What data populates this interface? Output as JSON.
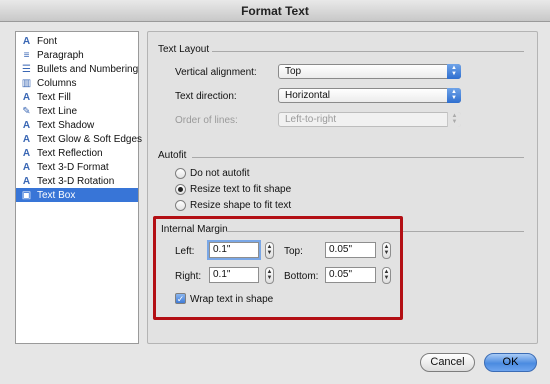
{
  "window": {
    "title": "Format Text"
  },
  "sidebar": {
    "items": [
      {
        "label": "Font",
        "icon": "font-icon",
        "glyph": "A"
      },
      {
        "label": "Paragraph",
        "icon": "paragraph-icon",
        "glyph": "≡"
      },
      {
        "label": "Bullets and Numbering",
        "icon": "bullets-icon",
        "glyph": "☰"
      },
      {
        "label": "Columns",
        "icon": "columns-icon",
        "glyph": "▥"
      },
      {
        "label": "Text Fill",
        "icon": "text-fill-icon",
        "glyph": "A"
      },
      {
        "label": "Text Line",
        "icon": "text-line-icon",
        "glyph": "✎"
      },
      {
        "label": "Text Shadow",
        "icon": "text-shadow-icon",
        "glyph": "A"
      },
      {
        "label": "Text Glow & Soft Edges",
        "icon": "text-glow-icon",
        "glyph": "A"
      },
      {
        "label": "Text Reflection",
        "icon": "text-reflection-icon",
        "glyph": "A"
      },
      {
        "label": "Text 3-D Format",
        "icon": "text-3d-format-icon",
        "glyph": "A"
      },
      {
        "label": "Text 3-D Rotation",
        "icon": "text-3d-rotation-icon",
        "glyph": "A"
      },
      {
        "label": "Text Box",
        "icon": "text-box-icon",
        "glyph": "▣",
        "selected": true
      }
    ]
  },
  "text_layout": {
    "title": "Text Layout",
    "vertical_alignment_label": "Vertical alignment:",
    "vertical_alignment_value": "Top",
    "text_direction_label": "Text direction:",
    "text_direction_value": "Horizontal",
    "order_of_lines_label": "Order of lines:",
    "order_of_lines_value": "Left-to-right"
  },
  "autofit": {
    "title": "Autofit",
    "options": [
      {
        "label": "Do not autofit",
        "selected": false
      },
      {
        "label": "Resize text to fit shape",
        "selected": true
      },
      {
        "label": "Resize shape to fit text",
        "selected": false
      }
    ]
  },
  "internal_margin": {
    "title": "Internal Margin",
    "left_label": "Left:",
    "left_value": "0.1\"",
    "right_label": "Right:",
    "right_value": "0.1\"",
    "top_label": "Top:",
    "top_value": "0.05\"",
    "bottom_label": "Bottom:",
    "bottom_value": "0.05\"",
    "wrap_label": "Wrap text in shape",
    "wrap_checked": true
  },
  "buttons": {
    "cancel": "Cancel",
    "ok": "OK"
  },
  "colors": {
    "selection": "#3875d7",
    "highlight": "#b30f14",
    "accent": "#4b8be0"
  }
}
